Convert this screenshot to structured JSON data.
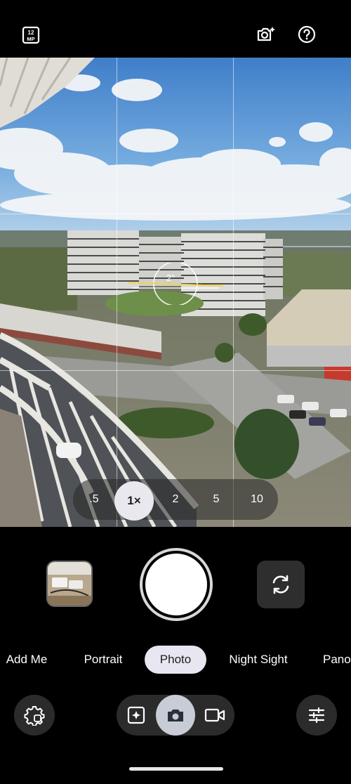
{
  "top_bar": {
    "resolution_badge": "12 MP",
    "lens_icon": "camera-sparkle-icon",
    "help_icon": "help-circle-icon"
  },
  "viewfinder": {
    "level_readout": "2°"
  },
  "zoom": {
    "options": [
      ".5",
      "1×",
      "2",
      "5",
      "10"
    ],
    "selected": "1×"
  },
  "modes": [
    "Add Me",
    "Portrait",
    "Photo",
    "Night Sight",
    "Pano"
  ],
  "selected_mode": "Photo",
  "bottom_controls": {
    "settings_icon": "settings-gear-icon",
    "motion_icon": "motion-photo-icon",
    "camera_icon": "camera-icon",
    "video_icon": "video-icon",
    "adjust_icon": "sliders-icon"
  },
  "colors": {
    "accent": "#e8e6f0",
    "background": "#000000"
  }
}
